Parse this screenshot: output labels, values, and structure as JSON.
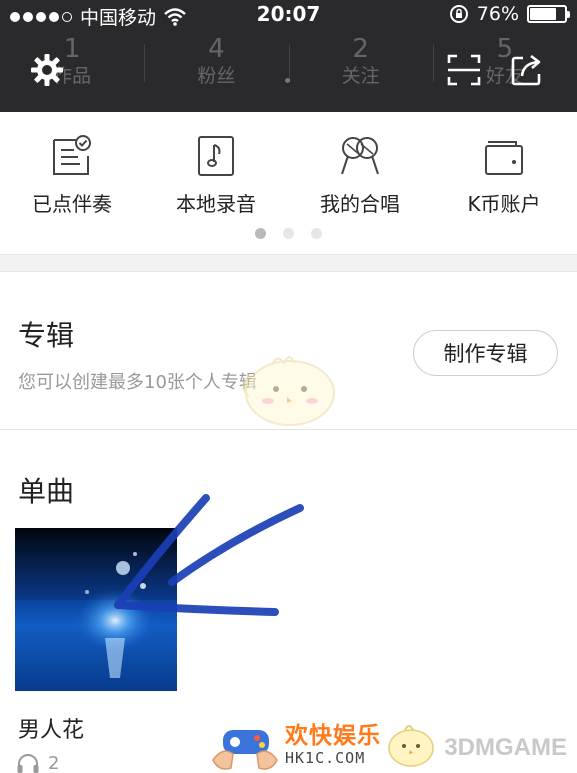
{
  "status_bar": {
    "carrier": "中国移动",
    "time": "20:07",
    "battery": "76%",
    "battery_level": 0.76
  },
  "profile_stats": [
    {
      "value": "1",
      "label": "作品"
    },
    {
      "value": "4",
      "label": "粉丝"
    },
    {
      "value": "2",
      "label": "关注"
    },
    {
      "value": "5",
      "label": "好友"
    }
  ],
  "header_icons": [
    "gear-icon",
    "scan-icon",
    "share-icon"
  ],
  "quick_actions": [
    {
      "label": "已点伴奏",
      "icon": "checklist-icon"
    },
    {
      "label": "本地录音",
      "icon": "music-note-icon"
    },
    {
      "label": "我的合唱",
      "icon": "microphones-icon"
    },
    {
      "label": "K币账户",
      "icon": "wallet-icon"
    }
  ],
  "pager": {
    "pages": 3,
    "active": 0
  },
  "album_section": {
    "title": "专辑",
    "description": "您可以创建最多10张个人专辑",
    "button": "制作专辑"
  },
  "singles_section": {
    "title": "单曲",
    "song": {
      "title": "男人花",
      "listens": "2"
    }
  },
  "watermark": {
    "site_name": "欢快娱乐",
    "url": "HK1C.COM",
    "brand": "3DMGAME"
  },
  "colors": {
    "header_bg": "#2a2a2c",
    "arrow": "#1a3fb5",
    "watermark_orange": "#ff7a1a"
  }
}
